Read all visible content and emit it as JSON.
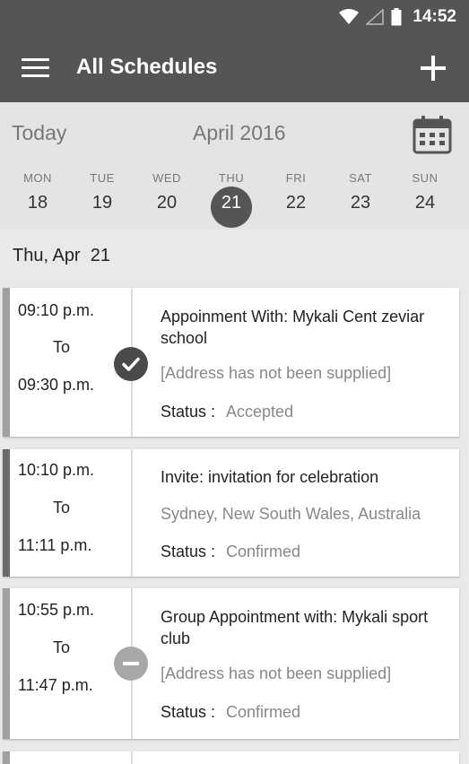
{
  "status_bar": {
    "time": "14:52",
    "icons": [
      "wifi-icon",
      "signal-icon",
      "battery-icon"
    ]
  },
  "app_bar": {
    "title": "All Schedules",
    "menu_icon": "hamburger-menu-icon",
    "add_icon": "plus-icon"
  },
  "calendar": {
    "today_label": "Today",
    "month_label": "April 2016",
    "calendar_icon": "calendar-icon",
    "days": [
      {
        "dow": "MON",
        "num": "18",
        "selected": false
      },
      {
        "dow": "TUE",
        "num": "19",
        "selected": false
      },
      {
        "dow": "WED",
        "num": "20",
        "selected": false
      },
      {
        "dow": "THU",
        "num": "21",
        "selected": true
      },
      {
        "dow": "FRI",
        "num": "22",
        "selected": false
      },
      {
        "dow": "SAT",
        "num": "23",
        "selected": false
      },
      {
        "dow": "SUN",
        "num": "24",
        "selected": false
      }
    ]
  },
  "date_header": "Thu, Apr  21",
  "schedules": [
    {
      "start": "09:10 p.m.",
      "to": "To",
      "end": "09:30 p.m.",
      "title": "Appoinment With: Mykali Cent zeviar school",
      "address": "[Address has not been supplied]",
      "status_label": "Status :",
      "status": "Accepted",
      "badge": "check-icon",
      "bar_color": "#a0a0a0"
    },
    {
      "start": "10:10 p.m.",
      "to": "To",
      "end": "11:11 p.m.",
      "title": "Invite: invitation for celebration",
      "address": "Sydney, New South Wales, Australia",
      "status_label": "Status :",
      "status": "Confirmed",
      "badge": "",
      "bar_color": "#6a6a6a"
    },
    {
      "start": "10:55 p.m.",
      "to": "To",
      "end": "11:47 p.m.",
      "title": "Group Appointment with: Mykali sport club",
      "address": "[Address has not been supplied]",
      "status_label": "Status :",
      "status": "Confirmed",
      "badge": "minus-circle-icon",
      "bar_color": "#a0a0a0"
    }
  ],
  "colors": {
    "app_bar": "#555555",
    "selected_day": "#555555",
    "accepted_badge": "#4a4a4a",
    "neutral_badge": "#a8a8a8"
  }
}
